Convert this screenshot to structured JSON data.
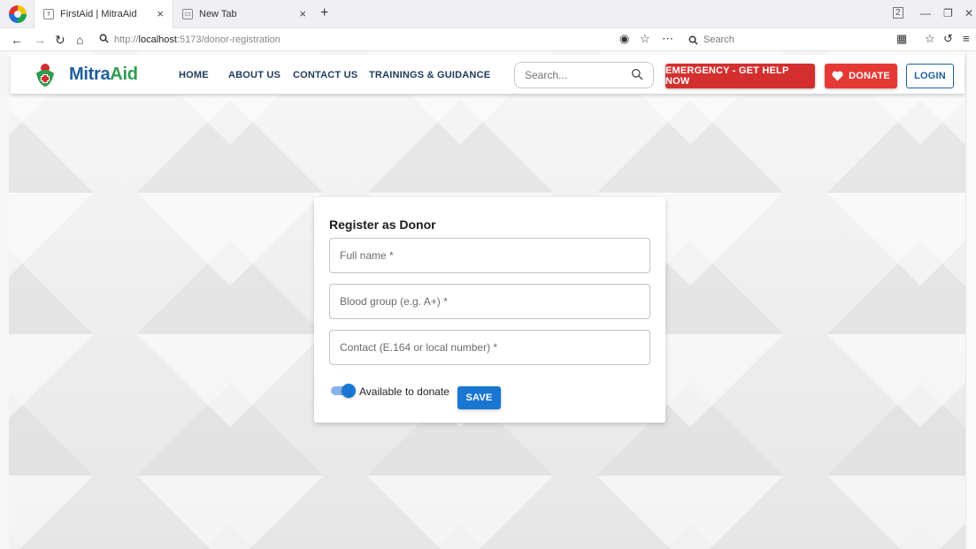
{
  "browser": {
    "tabs": [
      {
        "title": "FirstAid | MitraAid",
        "close": "×"
      },
      {
        "title": "New Tab",
        "close": "×"
      }
    ],
    "new_tab_glyph": "+",
    "tab_count": "2",
    "address": {
      "scheme": "http://",
      "host": "localhost",
      "rest": ":5173/donor-registration"
    },
    "search_placeholder": "Search"
  },
  "site": {
    "brand_main": "Mitra",
    "brand_accent": "Aid",
    "menu": [
      {
        "label": "HOME"
      },
      {
        "label": "ABOUT US"
      },
      {
        "label": "CONTACT US"
      },
      {
        "label": "TRAININGS & GUIDANCE"
      }
    ],
    "search_placeholder": "Search...",
    "emergency_label": "EMERGENCY - GET HELP NOW",
    "donate_label": "DONATE",
    "login_label": "LOGIN",
    "colors": {
      "primary": "#1976d2",
      "danger": "#d32f2f",
      "brand_blue": "#1f5f9e",
      "brand_green": "#2e9c4e"
    }
  },
  "form": {
    "title": "Register as Donor",
    "fields": [
      {
        "placeholder": "Full name *"
      },
      {
        "placeholder": "Blood group (e.g. A+) *"
      },
      {
        "placeholder": "Contact (E.164 or local number) *"
      }
    ],
    "available_label": "Available to donate",
    "available_checked": true,
    "save_label": "SAVE"
  }
}
